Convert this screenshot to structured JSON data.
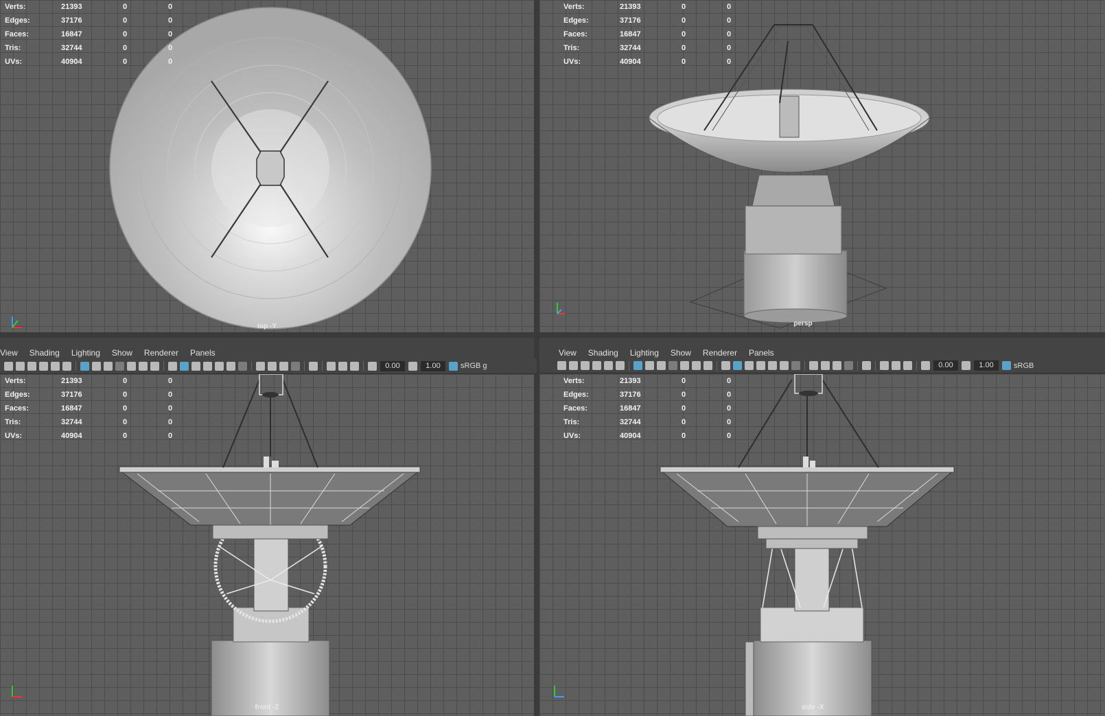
{
  "stats": {
    "labels": [
      "Verts:",
      "Edges:",
      "Faces:",
      "Tris:",
      "UVs:"
    ],
    "values": [
      "21393",
      "37176",
      "16847",
      "32744",
      "40904"
    ],
    "col2": [
      "0",
      "0",
      "0",
      "0",
      "0"
    ],
    "col3": [
      "0",
      "0",
      "0",
      "0",
      "0"
    ]
  },
  "viewports": {
    "top": {
      "camera": "top -Y"
    },
    "persp": {
      "camera": "persp"
    },
    "front": {
      "camera": "front -Z"
    },
    "side": {
      "camera": "side -X"
    }
  },
  "menus": {
    "left": [
      "View",
      "Shading",
      "Lighting",
      "Show",
      "Renderer",
      "Panels"
    ],
    "right": [
      "View",
      "Shading",
      "Lighting",
      "Show",
      "Renderer",
      "Panels"
    ]
  },
  "toolbar": {
    "exposure": "0.00",
    "gamma": "1.00",
    "colorspace_left": "sRGB g",
    "colorspace_right": "sRGB"
  },
  "colors": {
    "viewport_bg": "#5e5e5e",
    "grid_line": "#4c4c4c",
    "ui_bg": "#444444",
    "highlight": "#5aa3c8"
  }
}
